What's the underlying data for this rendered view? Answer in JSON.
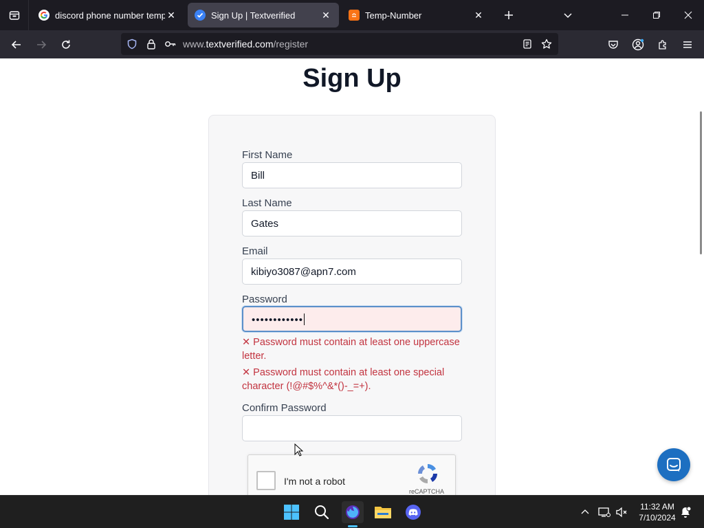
{
  "browser": {
    "tabs": [
      {
        "title": "discord phone number temp - (",
        "favicon": "google-icon",
        "active": false
      },
      {
        "title": "Sign Up | Textverified",
        "favicon": "textverified-check-icon",
        "active": true
      },
      {
        "title": "Temp-Number",
        "favicon": "temp-number-icon",
        "active": false
      }
    ],
    "url_prefix": "www.",
    "url_host": "textverified.com",
    "url_path": "/register"
  },
  "page": {
    "heading": "Sign Up",
    "form": {
      "first_name_label": "First Name",
      "first_name_value": "Bill",
      "last_name_label": "Last Name",
      "last_name_value": "Gates",
      "email_label": "Email",
      "email_value": "kibiyo3087@apn7.com",
      "password_label": "Password",
      "password_mask": "••••••••••••",
      "error_uppercase": "Password must contain at least one uppercase letter.",
      "error_special": "Password must contain at least one special character (!@#$%^&*()-_=+).",
      "error_mark": "✕",
      "confirm_password_label": "Confirm Password",
      "confirm_password_value": ""
    },
    "captcha": {
      "label": "I'm not a robot",
      "brand": "reCAPTCHA"
    }
  },
  "taskbar": {
    "time": "11:32 AM",
    "date": "7/10/2024"
  },
  "colors": {
    "tab_bg": "#1c1b22",
    "nav_bg": "#2b2a33",
    "error": "#c2333f",
    "chat_button": "#1d6fc1",
    "taskbar_accent": "#4cc2ff"
  }
}
